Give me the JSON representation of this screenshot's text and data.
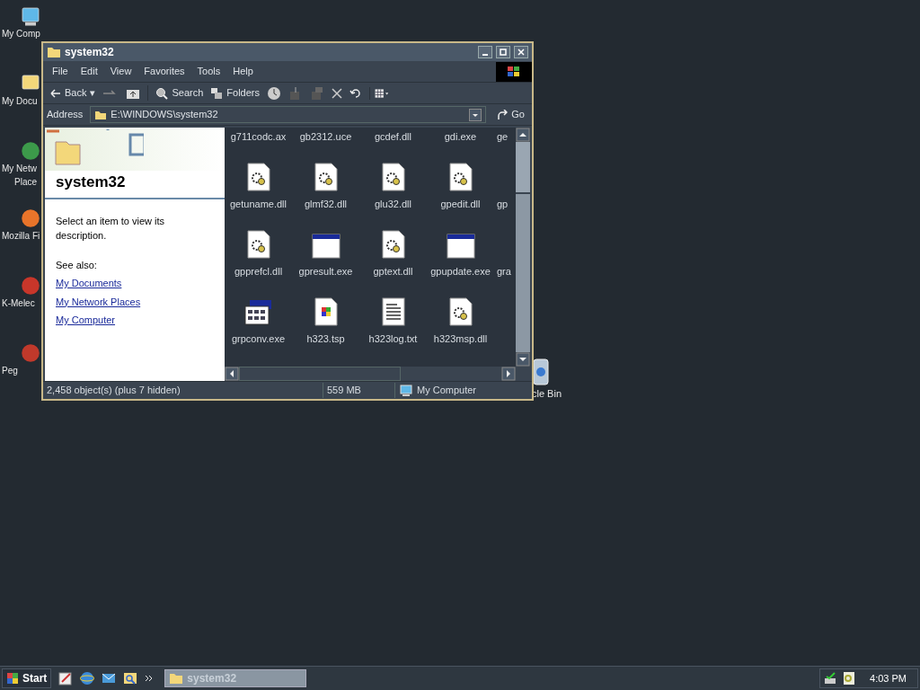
{
  "desktop_icons": [
    {
      "label": "My Comp",
      "kind": "computer"
    },
    {
      "label": "My Docu",
      "kind": "documents"
    },
    {
      "label": "My Netw",
      "label_2": "Place",
      "kind": "network"
    },
    {
      "label": "Mozilla Fi",
      "kind": "firefox"
    },
    {
      "label": "K-Melec",
      "kind": "kmeleon"
    },
    {
      "label": "Peg",
      "kind": "pegasus"
    }
  ],
  "recycle_bin": {
    "label": "cle Bin"
  },
  "window": {
    "title": "system32",
    "menu": [
      "File",
      "Edit",
      "View",
      "Favorites",
      "Tools",
      "Help"
    ],
    "toolbar": {
      "back": "Back",
      "back_menu": "▾",
      "search": "Search",
      "folders": "Folders"
    },
    "address": {
      "label": "Address",
      "value": "E:\\WINDOWS\\system32",
      "go": "Go"
    },
    "task_pane": {
      "title": "system32",
      "description": "Select an item to view its description.",
      "see_also": "See also:",
      "links": [
        "My Documents",
        "My Network Places",
        "My Computer"
      ]
    },
    "files": [
      [
        {
          "name": "g711codc.ax",
          "kind": "none"
        },
        {
          "name": "gb2312.uce",
          "kind": "none"
        },
        {
          "name": "gcdef.dll",
          "kind": "none"
        },
        {
          "name": "gdi.exe",
          "kind": "none"
        },
        {
          "name": "ge",
          "kind": "none"
        }
      ],
      [
        {
          "name": "getuname.dll",
          "kind": "dll"
        },
        {
          "name": "glmf32.dll",
          "kind": "dll"
        },
        {
          "name": "glu32.dll",
          "kind": "dll"
        },
        {
          "name": "gpedit.dll",
          "kind": "dll"
        },
        {
          "name": "gp",
          "kind": "none"
        }
      ],
      [
        {
          "name": "gpprefcl.dll",
          "kind": "dll"
        },
        {
          "name": "gpresult.exe",
          "kind": "app"
        },
        {
          "name": "gptext.dll",
          "kind": "dll"
        },
        {
          "name": "gpupdate.exe",
          "kind": "app"
        },
        {
          "name": "gra",
          "kind": "none"
        }
      ],
      [
        {
          "name": "grpconv.exe",
          "kind": "console"
        },
        {
          "name": "h323.tsp",
          "kind": "tsp"
        },
        {
          "name": "h323log.txt",
          "kind": "txt"
        },
        {
          "name": "h323msp.dll",
          "kind": "dll"
        }
      ]
    ],
    "status_bar": {
      "objects": "2,458 object(s) (plus 7 hidden)",
      "size": "559 MB",
      "zone": "My Computer"
    }
  },
  "taskbar": {
    "start": "Start",
    "tasks": [
      {
        "label": "system32",
        "selected": true
      }
    ],
    "clock": "4:03 PM"
  }
}
